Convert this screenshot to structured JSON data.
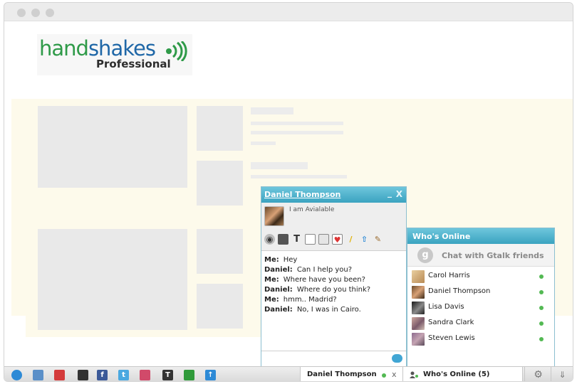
{
  "logo": {
    "part1": "hand",
    "part2": "shakes",
    "sub": "Professional"
  },
  "chat": {
    "title": "Daniel Thompson",
    "minimize": "_",
    "close": "X",
    "status": "I am Avialable",
    "toolbar_icons": [
      "webcam-icon",
      "screen-share-icon",
      "text-format-icon",
      "whiteboard-icon",
      "copy-icon",
      "card-icon",
      "pencil-icon",
      "upload-icon",
      "broom-icon"
    ],
    "messages": [
      {
        "who": "Me:",
        "text": "Hey"
      },
      {
        "who": "Daniel:",
        "text": "Can I help you?"
      },
      {
        "who": "Me:",
        "text": "Where have you been?"
      },
      {
        "who": "Daniel:",
        "text": "Where do you think?"
      },
      {
        "who": "Me:",
        "text": "hmm.. Madrid?"
      },
      {
        "who": "Daniel:",
        "text": "No, I was in Cairo."
      }
    ]
  },
  "online": {
    "title": "Who's Online",
    "gtalk_label": "Chat with Gtalk friends",
    "friends": [
      {
        "name": "Carol Harris"
      },
      {
        "name": "Daniel Thompson"
      },
      {
        "name": "Lisa Davis"
      },
      {
        "name": "Sandra Clark"
      },
      {
        "name": "Steven Lewis"
      }
    ]
  },
  "bar": {
    "icons": [
      "globe-icon",
      "photo-icon",
      "megaphone-icon",
      "game-icon",
      "facebook-icon",
      "twitter-icon",
      "square-icon",
      "text-icon",
      "share-icon",
      "upload-icon"
    ],
    "chat_tab": "Daniel Thompson",
    "chat_tab_close": "x",
    "online_tab": "Who's Online (5)"
  },
  "colors": {
    "accent": "#3aa3c0",
    "online": "#53b953"
  }
}
